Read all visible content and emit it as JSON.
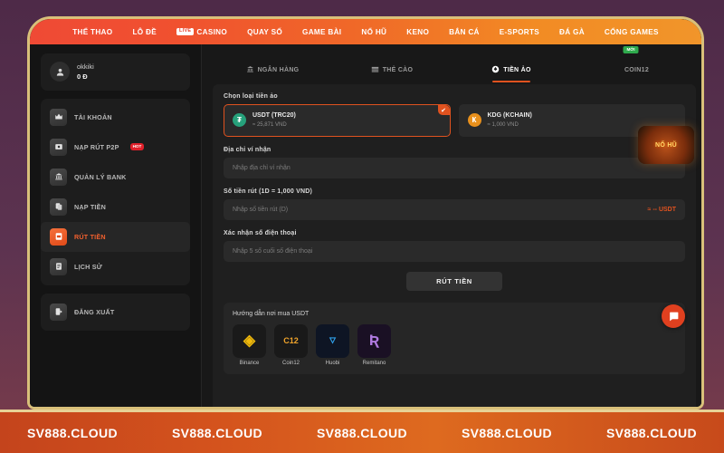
{
  "topnav": {
    "items": [
      {
        "label": "THỂ THAO",
        "badge": ""
      },
      {
        "label": "LÔ ĐỀ",
        "badge": ""
      },
      {
        "label": "CASINO",
        "badge": "LIVE"
      },
      {
        "label": "QUAY SỐ",
        "badge": ""
      },
      {
        "label": "GAME BÀI",
        "badge": ""
      },
      {
        "label": "NỔ HŨ",
        "badge": ""
      },
      {
        "label": "KENO",
        "badge": ""
      },
      {
        "label": "BẮN CÁ",
        "badge": ""
      },
      {
        "label": "E-SPORTS",
        "badge": ""
      },
      {
        "label": "ĐÁ GÀ",
        "badge": ""
      },
      {
        "label": "CỔNG GAMES",
        "badge": ""
      }
    ]
  },
  "sidebar": {
    "profile": {
      "username": "okkiki",
      "balance": "0 Đ",
      "avatar_icon": "user-icon"
    },
    "items": [
      {
        "label": "TÀI KHOẢN",
        "icon": "crown-icon",
        "badge": "",
        "active": false
      },
      {
        "label": "NẠP RÚT P2P",
        "icon": "exchange-icon",
        "badge": "HOT",
        "active": false
      },
      {
        "label": "QUẢN LÝ BANK",
        "icon": "bank-icon",
        "badge": "",
        "active": false
      },
      {
        "label": "NẠP TIỀN",
        "icon": "deposit-icon",
        "badge": "",
        "active": false
      },
      {
        "label": "RÚT TIỀN",
        "icon": "withdraw-icon",
        "badge": "",
        "active": true
      },
      {
        "label": "LỊCH SỬ",
        "icon": "history-icon",
        "badge": "",
        "active": false
      }
    ],
    "logout": {
      "label": "ĐĂNG XUẤT",
      "icon": "logout-icon"
    }
  },
  "tabs": [
    {
      "label": "NGÂN HÀNG",
      "icon": "bank-icon",
      "badge": "",
      "active": false
    },
    {
      "label": "THẺ CÀO",
      "icon": "card-icon",
      "badge": "",
      "active": false
    },
    {
      "label": "TIỀN ẢO",
      "icon": "crypto-icon",
      "badge": "",
      "active": true
    },
    {
      "label": "COIN12",
      "icon": "coin12-icon",
      "badge": "MỚI",
      "active": false
    }
  ],
  "form": {
    "coin_label": "Chọn loại tiền ảo",
    "coins": [
      {
        "name": "USDT (TRC20)",
        "rate": "≈ 25,871 VND",
        "symbol": "₮",
        "color": "#26a17b",
        "selected": true
      },
      {
        "name": "KDG (KCHAIN)",
        "rate": "≈ 1,000 VND",
        "symbol": "Ҝ",
        "color": "#e8901c",
        "selected": false
      }
    ],
    "check_glyph": "✔",
    "wallet_label": "Địa chỉ ví nhận",
    "wallet_placeholder": "Nhập địa chỉ ví nhận",
    "wallet_value": "",
    "amount_label": "Số tiền rút (1D = 1,000 VND)",
    "amount_placeholder": "Nhập số tiền rút (D)",
    "amount_value": "",
    "amount_suffix": "≈ -- USDT",
    "phone_label": "Xác nhận số điện thoại",
    "phone_placeholder": "Nhập 5 số cuối số điện thoại",
    "phone_value": "",
    "submit_label": "RÚT TIỀN"
  },
  "guide": {
    "title": "Hướng dẫn nơi mua USDT",
    "items": [
      {
        "name": "Binance",
        "glyph": "◈",
        "fg": "#f0b90b",
        "bg": "#1a1a1a"
      },
      {
        "name": "Coin12",
        "glyph": "C12",
        "fg": "#f0a42b",
        "bg": "#191919"
      },
      {
        "name": "Huobi",
        "glyph": "🜄",
        "fg": "#2f9fe8",
        "bg": "#0e1524"
      },
      {
        "name": "Remitano",
        "glyph": "Ʀ",
        "fg": "#b07ae0",
        "bg": "#1a1024"
      }
    ]
  },
  "floating": {
    "promo_text": "NỔ HŨ",
    "chat_icon": "chat-bubble-icon",
    "chat_glyph": "💬"
  },
  "banner": {
    "items": [
      "SV888.CLOUD",
      "SV888.CLOUD",
      "SV888.CLOUD",
      "SV888.CLOUD",
      "SV888.CLOUD"
    ]
  },
  "colors": {
    "accent": "#e0521f",
    "nav_start": "#ef4a35",
    "nav_end": "#f1952a",
    "frame": "#d9c07a",
    "hot": "#e0202a",
    "new": "#2faa4d"
  }
}
